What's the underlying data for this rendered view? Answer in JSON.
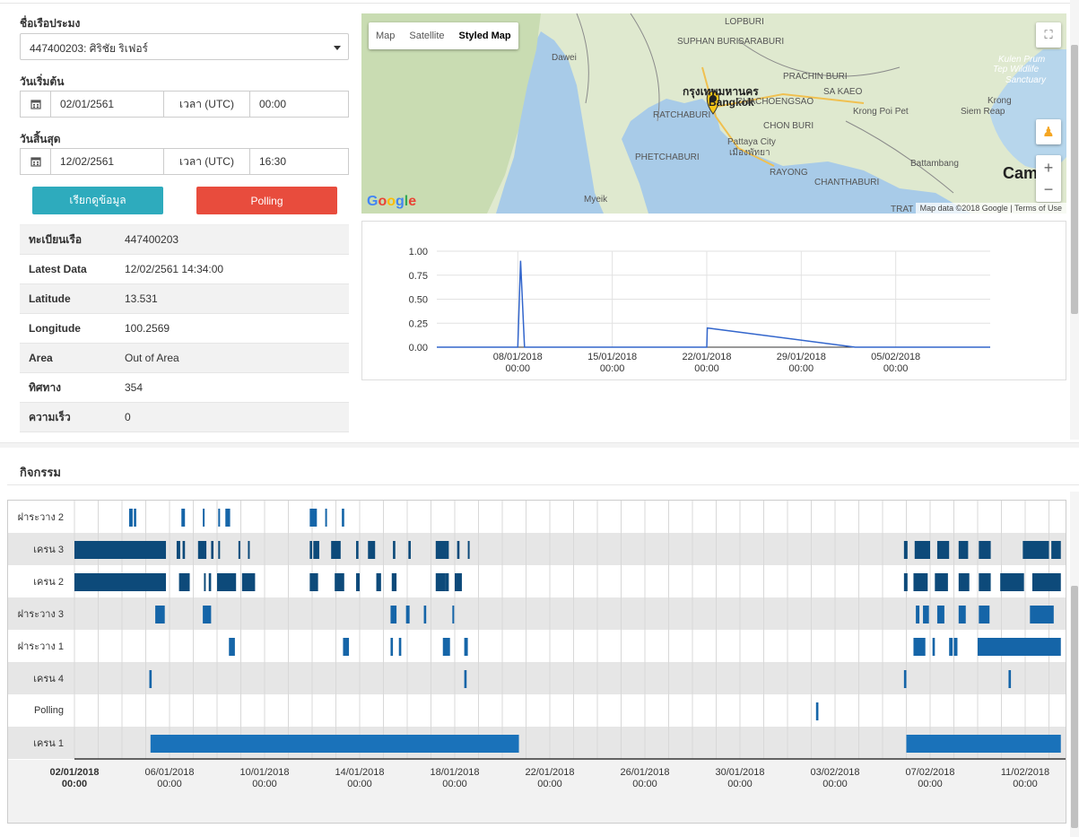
{
  "form": {
    "vessel_label": "ชื่อเรือประมง",
    "vessel_value": "447400203: ศิริชัย ริเฟอร์",
    "start_label": "วันเริ่มต้น",
    "start_date": "02/01/2561",
    "start_time_label": "เวลา (UTC)",
    "start_time": "00:00",
    "end_label": "วันสิ้นสุด",
    "end_date": "12/02/2561",
    "end_time_label": "เวลา (UTC)",
    "end_time": "16:30",
    "fetch_button": "เรียกดูข้อมูล",
    "polling_button": "Polling"
  },
  "info": [
    {
      "key": "ทะเบียนเรือ",
      "value": "447400203"
    },
    {
      "key": "Latest Data",
      "value": "12/02/2561 14:34:00"
    },
    {
      "key": "Latitude",
      "value": "13.531"
    },
    {
      "key": "Longitude",
      "value": "100.2569"
    },
    {
      "key": "Area",
      "value": "Out of Area"
    },
    {
      "key": "ทิศทาง",
      "value": "354"
    },
    {
      "key": "ความเร็ว",
      "value": "0"
    }
  ],
  "map": {
    "types": [
      "Map",
      "Satellite",
      "Styled Map"
    ],
    "selected_type": "Styled Map",
    "attribution": "Map data ©2018 Google | Terms of Use",
    "logo": "Google",
    "labels": [
      {
        "text": "LOPBURI"
      },
      {
        "text": "SUPHAN BURI"
      },
      {
        "text": "SARABURI"
      },
      {
        "text": "Dawei"
      },
      {
        "text": "Bangkok"
      },
      {
        "text": "กรุงเทพมหานคร"
      },
      {
        "text": "PRACHIN BURI"
      },
      {
        "text": "SA KAEO"
      },
      {
        "text": "RATCHABURI"
      },
      {
        "text": "CHACHOENGSAO"
      },
      {
        "text": "CHON BURI"
      },
      {
        "text": "Pattaya City"
      },
      {
        "text": "เมืองพัทยา"
      },
      {
        "text": "PHETCHABURI"
      },
      {
        "text": "RAYONG"
      },
      {
        "text": "CHANTHABURI"
      },
      {
        "text": "Krong Poi Pet"
      },
      {
        "text": "Krong"
      },
      {
        "text": "Siem Reap"
      },
      {
        "text": "Battambang"
      },
      {
        "text": "Kulen Prum"
      },
      {
        "text": "Tep Wildlife"
      },
      {
        "text": "Sanctuary"
      },
      {
        "text": "Myeik"
      },
      {
        "text": "TRAT"
      },
      {
        "text": "Cam"
      }
    ]
  },
  "chart_data": {
    "type": "line",
    "title": "",
    "xlabel": "",
    "ylabel": "",
    "ylim": [
      0,
      1
    ],
    "y_ticks": [
      "1.00",
      "0.75",
      "0.50",
      "0.25",
      "0.00"
    ],
    "x_ticks": [
      {
        "date": "08/01/2018",
        "time": "00:00"
      },
      {
        "date": "15/01/2018",
        "time": "00:00"
      },
      {
        "date": "22/01/2018",
        "time": "00:00"
      },
      {
        "date": "29/01/2018",
        "time": "00:00"
      },
      {
        "date": "05/02/2018",
        "time": "00:00"
      }
    ],
    "series": [
      {
        "color": "#3366cc",
        "points": [
          [
            "2018-01-02",
            0
          ],
          [
            "2018-01-08",
            0
          ],
          [
            "2018-01-08 05:00",
            0.9
          ],
          [
            "2018-01-08 12:00",
            0
          ],
          [
            "2018-01-22",
            0
          ],
          [
            "2018-01-22 01:00",
            0.2
          ],
          [
            "2018-02-02",
            0
          ],
          [
            "2018-02-12",
            0
          ]
        ]
      }
    ]
  },
  "activity": {
    "title": "กิจกรรม",
    "rows": [
      {
        "label": "ฝาระวาง 2",
        "color": "#1565a8",
        "bars": [
          [
            2.3,
            2.45
          ],
          [
            2.5,
            2.6
          ],
          [
            4.5,
            4.65
          ],
          [
            5.4,
            5.45
          ],
          [
            6.05,
            6.1
          ],
          [
            6.35,
            6.55
          ],
          [
            9.9,
            10.2
          ],
          [
            10.55,
            10.6
          ],
          [
            11.25,
            11.35
          ],
          [
            45.4,
            45.6
          ],
          [
            46.1,
            46.2
          ],
          [
            46.6,
            46.7
          ],
          [
            47.1,
            47.3
          ],
          [
            47.65,
            47.95
          ],
          [
            48.4,
            48.65
          ],
          [
            49.1,
            49.25
          ],
          [
            51.3,
            51.5
          ],
          [
            51.9,
            52.1
          ],
          [
            52.1,
            52.3
          ]
        ]
      },
      {
        "label": "เครน 3",
        "color": "#0d4a7a",
        "bars": [
          [
            0,
            3.85
          ],
          [
            4.3,
            4.45
          ],
          [
            4.55,
            4.65
          ],
          [
            5.2,
            5.55
          ],
          [
            5.75,
            5.85
          ],
          [
            6.05,
            6.1
          ],
          [
            6.9,
            6.95
          ],
          [
            7.3,
            7.35
          ],
          [
            9.9,
            10.0
          ],
          [
            10.05,
            10.3
          ],
          [
            10.8,
            11.2
          ],
          [
            11.85,
            11.95
          ],
          [
            12.35,
            12.65
          ],
          [
            13.4,
            13.5
          ],
          [
            14.05,
            14.15
          ],
          [
            15.2,
            15.75
          ],
          [
            16.1,
            16.2
          ],
          [
            16.55,
            16.6
          ],
          [
            34.9,
            35.05
          ],
          [
            35.35,
            36.0
          ],
          [
            36.3,
            36.8
          ],
          [
            37.2,
            37.6
          ],
          [
            38.05,
            38.55
          ],
          [
            39.9,
            41.0
          ],
          [
            41.1,
            41.5
          ]
        ]
      },
      {
        "label": "เครน 2",
        "color": "#0d4a7a",
        "bars": [
          [
            0,
            3.85
          ],
          [
            4.4,
            4.85
          ],
          [
            5.45,
            5.5
          ],
          [
            5.65,
            5.75
          ],
          [
            6.0,
            6.8
          ],
          [
            7.05,
            7.6
          ],
          [
            9.9,
            10.25
          ],
          [
            10.95,
            11.35
          ],
          [
            11.85,
            12.0
          ],
          [
            12.7,
            12.9
          ],
          [
            13.35,
            13.55
          ],
          [
            15.2,
            15.6
          ],
          [
            15.6,
            15.75
          ],
          [
            16.0,
            16.3
          ],
          [
            34.9,
            35.05
          ],
          [
            35.3,
            35.9
          ],
          [
            36.2,
            36.75
          ],
          [
            37.2,
            37.65
          ],
          [
            38.05,
            38.55
          ],
          [
            38.95,
            39.95
          ],
          [
            40.3,
            41.5
          ]
        ]
      },
      {
        "label": "ฝาระวาง 3",
        "color": "#1565a8",
        "bars": [
          [
            3.4,
            3.8
          ],
          [
            5.4,
            5.75
          ],
          [
            13.3,
            13.55
          ],
          [
            13.95,
            14.1
          ],
          [
            14.7,
            14.8
          ],
          [
            15.9,
            15.95
          ],
          [
            35.4,
            35.55
          ],
          [
            35.7,
            35.95
          ],
          [
            36.3,
            36.6
          ],
          [
            37.2,
            37.5
          ],
          [
            38.05,
            38.5
          ],
          [
            40.2,
            41.2
          ]
        ]
      },
      {
        "label": "ฝาระวาง 1",
        "color": "#1565a8",
        "bars": [
          [
            6.5,
            6.75
          ],
          [
            11.3,
            11.55
          ],
          [
            13.3,
            13.4
          ],
          [
            13.65,
            13.75
          ],
          [
            15.5,
            15.8
          ],
          [
            16.4,
            16.55
          ],
          [
            35.3,
            35.8
          ],
          [
            36.1,
            36.2
          ],
          [
            36.8,
            36.95
          ],
          [
            37.0,
            37.15
          ],
          [
            38.0,
            41.5
          ]
        ]
      },
      {
        "label": "เครน 4",
        "color": "#1565a8",
        "bars": [
          [
            3.15,
            3.25
          ],
          [
            16.4,
            16.5
          ],
          [
            34.9,
            35.0
          ],
          [
            39.3,
            39.4
          ]
        ]
      },
      {
        "label": "Polling",
        "color": "#1565a8",
        "bars": [
          [
            31.2,
            31.3
          ]
        ]
      },
      {
        "label": "เครน 1",
        "color": "#1a72ba",
        "bars": [
          [
            3.2,
            18.7
          ],
          [
            35.0,
            41.5
          ]
        ]
      }
    ],
    "x_ticks": [
      {
        "date": "02/01/2018",
        "time": "00:00",
        "bold": true
      },
      {
        "date": "06/01/2018",
        "time": "00:00"
      },
      {
        "date": "10/01/2018",
        "time": "00:00"
      },
      {
        "date": "14/01/2018",
        "time": "00:00"
      },
      {
        "date": "18/01/2018",
        "time": "00:00"
      },
      {
        "date": "22/01/2018",
        "time": "00:00"
      },
      {
        "date": "26/01/2018",
        "time": "00:00"
      },
      {
        "date": "30/01/2018",
        "time": "00:00"
      },
      {
        "date": "03/02/2018",
        "time": "00:00"
      },
      {
        "date": "07/02/2018",
        "time": "00:00"
      },
      {
        "date": "11/02/2018",
        "time": "00:00"
      }
    ]
  }
}
